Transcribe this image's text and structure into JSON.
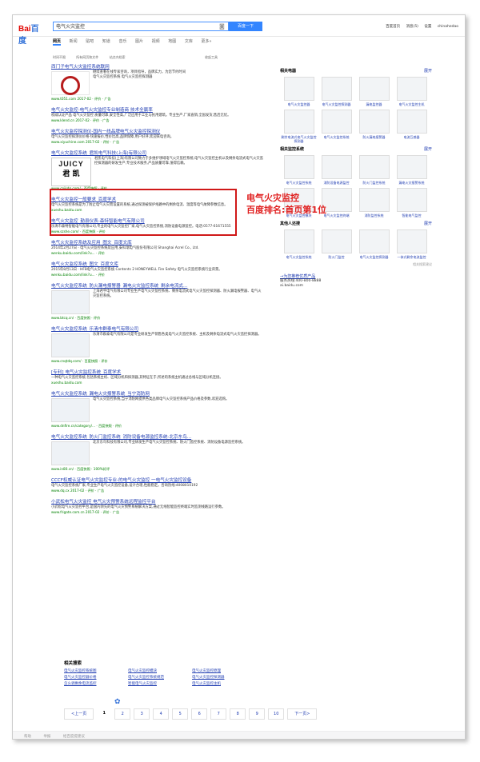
{
  "header": {
    "logo_red": "Bai",
    "logo_blue": "百度",
    "query": "电气火灾监控",
    "search_button": "百度一下",
    "top_links": [
      "百度首页",
      "消息(5)",
      "设置",
      "chinahedao"
    ]
  },
  "tabs": [
    "网页",
    "新闻",
    "贴吧",
    "知道",
    "音乐",
    "图片",
    "视频",
    "地图",
    "文库",
    "更多»"
  ],
  "tools": {
    "left": [
      "时间不限",
      "所有网页和文件",
      "站点内检索"
    ],
    "right": "收起工具"
  },
  "results": [
    {
      "title": "西门子电气火灾监控系统联网",
      "desc": "继续查看在线专家咨询，项目指导，品牌实力，为您节约时间",
      "desc2": "电气火灾监控系统  电气火灾监控探测器",
      "url": "www.t051.com  2017-02  ·  评价  ·  广告",
      "thumb": "red"
    },
    {
      "title": "电气火灾监控-电气火灾监控专业制造商 技术全赢率",
      "desc": "权威认证产品 电气火灾监控 质量可靠,安全性高,广泛应用于工业与民用建筑。专业生产,厂家直销,全国发货,售后无忧。",
      "url": "www.klend.cn  2017-02  ·  评价  ·  广告"
    },
    {
      "title": "电气火灾监控探测仪-国内一线品牌电气火灾监控探测仪",
      "desc": "电气火灾监控探测仪价格-快速报价,性价比高,品牌保障,用户好评,欢迎来电咨询。",
      "url": "www.xiyuchine.com  2017-02  ·  评价  ·  广告"
    },
    {
      "title": "电气火灾监控系统_君凯电气科技(上海)有限公司",
      "desc": "君凯电气科技(上海)有限公司致力于多维护领域电气火灾监控系统,电气火灾监控主机以及剩余电流式电气火灾监控探测器的研发生产,专业技术服务,产品质量可靠,值得信赖。",
      "url": "www.cnjkdq.com/  ·  百度快照  ·  评价",
      "thumb": "juicy"
    },
    {
      "title": "电气火灾监控一般要求_百度学术",
      "desc": "电气火灾监控系统是为了防止电气火灾而设置的系统,通过探测被保护线路中的剩余电流、温度等电气故障参数信息。",
      "url": "xueshu.baidu.com"
    },
    {
      "title": "电气火灾监控_勤县仪表-森特智能电气有限公司",
      "desc": "乐清市森特智能电气有限公司,专业的电气火灾监控厂家,电气火灾监控系统,消防设备电源监控。电话:0577-61671555",
      "url": "www.szshe.com/  ·  百度快照  ·  评价"
    },
    {
      "title": "电气火灾监控系统及应用_图文_百度文库",
      "desc": "2014年2月27日 · 电气火灾监控系统及应用,安科瑞电气股份有限公司 Shanghai Acrel Co., Ltd.",
      "url": "wenku.baidu.com/link?u...  ·  评价"
    },
    {
      "title": "电气火灾监控系统_图文_百度文库",
      "desc": "2015年8月13日 · HFB电气火灾监控系统 Contents 2 HONEYWELL Fire Safety 电气火灾监控系统行业背景。",
      "url": "wenku.baidu.com/link?u...  ·  评价"
    },
    {
      "title": "电气火灾监控系统_防火漏电报警器_漏电火灾监控系统_剩余电流式...",
      "desc": "上海君宇电气有限公司专业生产电气火灾监控系统、剩余电流式电气火灾监控探测器、防火漏电报警器、电气火灾监控系统。",
      "url": "www.btcq.cn/  ·  百度快照  ·  评价",
      "thumb": "plain"
    },
    {
      "title": "电气火灾监控系统_乐清市群泰电气有限公司",
      "desc": "乐清市群泰电气有限公司是专业研发生产销售各类电气火灾监控系统、主机及剩余电流式电气火灾监控探测器。",
      "url": "www.cnqtdq.com/  ·  百度快照  ·  评价",
      "thumb": "plain"
    },
    {
      "title": "[专利] 电气火灾监控系统_百度学术",
      "desc": "一种电气火灾监控系统,包括系统主机、区域分机和探测器,其特征在于,所述的系统主机通过总线与区域分机连接。",
      "url": "xueshu.baidu.com"
    },
    {
      "title": "电气火灾监控系统_漏电火灾报警系统_当宁消防网",
      "desc": "电气火灾监控系统,当宁消防网提供各类品牌电气火灾监控系统产品价格及参数,欢迎选购。",
      "url": "www.dnfire.cn/category/...  ·  百度快照  ·  评价",
      "thumb": "plain"
    },
    {
      "title": "电气火灾监控系统_防火门监控系统_消防设备电源监控系统-北京东鸟...",
      "desc": "北京东鸟科技有限公司,专业研发生产电气火灾监控系统、防火门监控系统、消防设备电源监控系统。",
      "url": "www.in80.cn/  ·  百度快照  ·  100%好评",
      "thumb": "plain"
    },
    {
      "title": "CCCF权威认证电气火灾监控专业-的电气火灾监控 一电气火灾监控设备",
      "desc": "电气火灾监控系统厂家,专业生产电气火灾监控设备,设计合理,性能稳定。咨询热线:4008010192",
      "url": "www.dq.cx  2017-02  ·  评价  ·  广告"
    },
    {
      "title": "小武松电气火灾监控 电气火灾预警系统远程监控平台",
      "desc": "小武松电气火灾监控平台,是国内领先的电气火灾预警系统解决方案,通过无线智能监控终端实时监测线路运行参数。",
      "url": "www.frigate.com.cn  2017-02  ·  评价  ·  广告"
    }
  ],
  "annotation": {
    "line1": "电气火灾监控",
    "line2": "百度排名:首页第1位"
  },
  "sidebar": {
    "section1": {
      "title": "相关电器",
      "more": "展开",
      "items": [
        "电气火灾监控器",
        "电气火灾监控探测器",
        "漏电监控器",
        "电气火灾监控主机",
        "剩余电流式电气火灾监控探测器",
        "电气火灾监控系统",
        "防火漏电报警器",
        "电流互感器"
      ]
    },
    "section2": {
      "title": "相关监控系统",
      "more": "展开",
      "items": [
        "电气火灾监控系统",
        "消防设备电源监控",
        "防火门监控系统",
        "漏电火灾报警系统",
        "电气火灾监控模块",
        "电气火灾监控终端",
        "消防监控系统",
        "智能电气监控"
      ]
    },
    "section3": {
      "title": "其他人还搜",
      "more": "展开",
      "items": [
        "电气火灾监控系统",
        "防火门监控",
        "电气火灾监控探测器",
        "一体式剩余电流监控"
      ]
    },
    "foot": "相关搜索建议",
    "service_link": "→为您推荐优质产品",
    "service_text": "服务热线:400-800-8888",
    "service_url": "ai.baidu.com"
  },
  "related": {
    "title": "相关搜索",
    "items": [
      "电气火灾监控系统图",
      "电气火灾监控模块",
      "电气火灾监控原理",
      "电气火灾监控器价格",
      "电气火灾监控系统规范",
      "电气火灾监控探测器",
      "怎么调剩余电流监控",
      "智能电气火灾监控",
      "电气火灾监控主机"
    ]
  },
  "pager": {
    "prev": "<上一页",
    "pages": [
      "1",
      "2",
      "3",
      "4",
      "5",
      "6",
      "7",
      "8",
      "9",
      "10"
    ],
    "next": "下一页>"
  },
  "footer": [
    "帮助",
    "举报",
    "给百度提建议"
  ]
}
